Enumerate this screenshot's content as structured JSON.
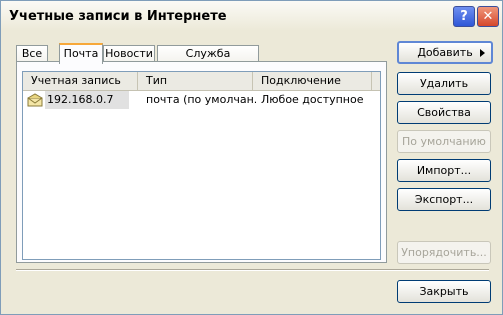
{
  "window": {
    "title": "Учетные записи в Интернете",
    "help_glyph": "?",
    "close_glyph": "✕"
  },
  "tabs": [
    {
      "label": "Все"
    },
    {
      "label": "Почта"
    },
    {
      "label": "Новости"
    },
    {
      "label": "Служба каталогов"
    }
  ],
  "list": {
    "columns": [
      "Учетная запись",
      "Тип",
      "Подключение"
    ],
    "rows": [
      {
        "account": "192.168.0.7",
        "type": "почта (по умолчан...",
        "connection": "Любое доступное",
        "icon": "mail-account-icon"
      }
    ]
  },
  "buttons": {
    "add": "Добавить",
    "remove": "Удалить",
    "properties": "Свойства",
    "set_default": "По умолчанию",
    "import": "Импорт...",
    "export": "Экспорт...",
    "order": "Упорядочить...",
    "close": "Закрыть"
  }
}
